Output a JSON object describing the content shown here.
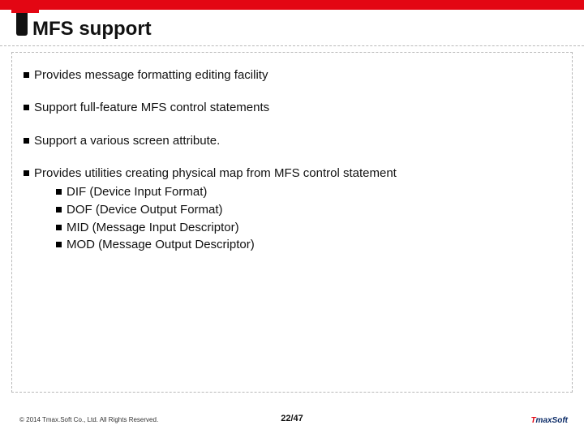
{
  "title": "MFS support",
  "bullets": [
    {
      "text": "Provides message formatting editing facility"
    },
    {
      "text": "Support full-feature MFS control statements"
    },
    {
      "text": "Support a various screen attribute."
    },
    {
      "text": "Provides utilities creating physical map from MFS control statement",
      "sub": [
        "DIF (Device Input Format)",
        "DOF (Device Output Format)",
        "MID (Message Input Descriptor)",
        "MOD (Message Output Descriptor)"
      ]
    }
  ],
  "footer": {
    "copyright": "© 2014 Tmax.Soft Co., Ltd. All Rights Reserved.",
    "page": "22/47",
    "logo_t": "T",
    "logo_rest": "maxSoft"
  }
}
